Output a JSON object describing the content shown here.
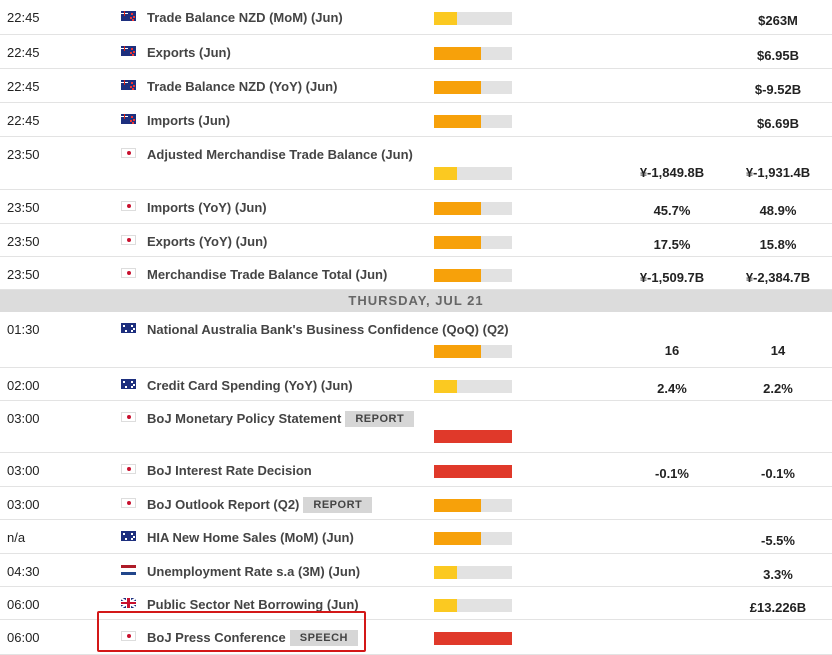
{
  "impact_colors": {
    "low": "#fbc921",
    "medium": "#f7a10a",
    "high": "#e0392a",
    "empty": "#e2e2e2"
  },
  "impact_levels": {
    "low": 0.3,
    "medium": 0.6,
    "high": 1.0
  },
  "rows": [
    {
      "time": "22:45",
      "flag": "nz",
      "event": "Trade Balance NZD (MoM) (Jun)",
      "impact": "low",
      "actual": "",
      "previous": "$263M"
    },
    {
      "time": "22:45",
      "flag": "nz",
      "event": "Exports (Jun)",
      "impact": "medium",
      "actual": "",
      "previous": "$6.95B"
    },
    {
      "time": "22:45",
      "flag": "nz",
      "event": "Trade Balance NZD (YoY) (Jun)",
      "impact": "medium",
      "actual": "",
      "previous": "$-9.52B"
    },
    {
      "time": "22:45",
      "flag": "nz",
      "event": "Imports (Jun)",
      "impact": "medium",
      "actual": "",
      "previous": "$6.69B"
    },
    {
      "time": "23:50",
      "flag": "jp",
      "event": "Adjusted Merchandise Trade Balance (Jun)",
      "impact": "low",
      "actual": "¥-1,849.8B",
      "previous": "¥-1,931.4B"
    },
    {
      "time": "23:50",
      "flag": "jp",
      "event": "Imports (YoY) (Jun)",
      "impact": "medium",
      "actual": "45.7%",
      "previous": "48.9%"
    },
    {
      "time": "23:50",
      "flag": "jp",
      "event": "Exports (YoY) (Jun)",
      "impact": "medium",
      "actual": "17.5%",
      "previous": "15.8%"
    },
    {
      "time": "23:50",
      "flag": "jp",
      "event": "Merchandise Trade Balance Total (Jun)",
      "impact": "medium",
      "actual": "¥-1,509.7B",
      "previous": "¥-2,384.7B"
    },
    {
      "day_header": "THURSDAY, JUL 21"
    },
    {
      "time": "01:30",
      "flag": "au",
      "event": "National Australia Bank's Business Confidence (QoQ) (Q2)",
      "impact": "medium",
      "actual": "16",
      "previous": "14"
    },
    {
      "time": "02:00",
      "flag": "au",
      "event": "Credit Card Spending (YoY) (Jun)",
      "impact": "low",
      "actual": "2.4%",
      "previous": "2.2%"
    },
    {
      "time": "03:00",
      "flag": "jp",
      "event": "BoJ Monetary Policy Statement",
      "badge": "REPORT",
      "impact": "high",
      "actual": "",
      "previous": ""
    },
    {
      "time": "03:00",
      "flag": "jp",
      "event": "BoJ Interest Rate Decision",
      "impact": "high",
      "actual": "-0.1%",
      "previous": "-0.1%"
    },
    {
      "time": "03:00",
      "flag": "jp",
      "event": "BoJ Outlook Report (Q2)",
      "badge": "REPORT",
      "impact": "medium",
      "actual": "",
      "previous": ""
    },
    {
      "time": "n/a",
      "flag": "au",
      "event": "HIA New Home Sales (MoM) (Jun)",
      "impact": "medium",
      "actual": "",
      "previous": "-5.5%"
    },
    {
      "time": "04:30",
      "flag": "nl",
      "event": "Unemployment Rate s.a (3M) (Jun)",
      "impact": "low",
      "actual": "",
      "previous": "3.3%"
    },
    {
      "time": "06:00",
      "flag": "gb",
      "event": "Public Sector Net Borrowing (Jun)",
      "impact": "low",
      "actual": "",
      "previous": "£13.226B"
    },
    {
      "time": "06:00",
      "flag": "jp",
      "event": "BoJ Press Conference",
      "badge": "SPEECH",
      "impact": "high",
      "actual": "",
      "previous": "",
      "highlighted": true
    }
  ]
}
